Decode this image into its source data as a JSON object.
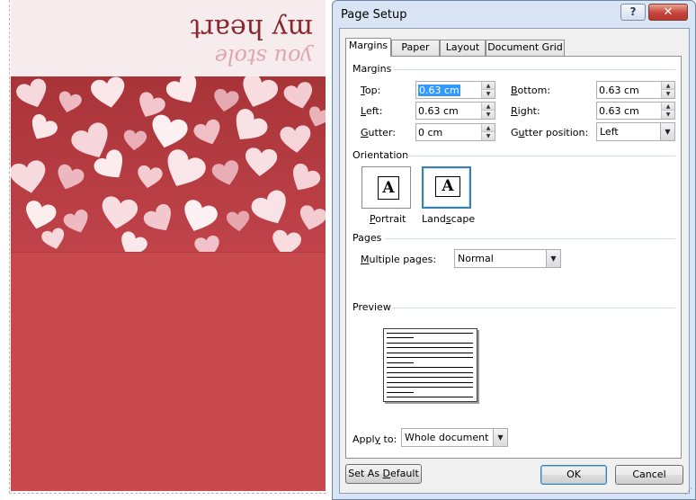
{
  "card": {
    "line1": "you stole",
    "line2": "my heart"
  },
  "dialog": {
    "title": "Page Setup",
    "help_label": "?",
    "close_label": "✕",
    "tabs": [
      {
        "label": "Margins",
        "active": true
      },
      {
        "label": "Paper",
        "active": false
      },
      {
        "label": "Layout",
        "active": false
      },
      {
        "label": "Document Grid",
        "active": false
      }
    ],
    "margins": {
      "section": "Margins",
      "top_label": "Top:",
      "top": "0.63 cm",
      "bottom_label": "Bottom:",
      "bottom": "0.63 cm",
      "left_label": "Left:",
      "left": "0.63 cm",
      "right_label": "Right:",
      "right": "0.63 cm",
      "gutter_label": "Gutter:",
      "gutter": "0 cm",
      "gutter_pos_label": "Gutter position:",
      "gutter_pos": "Left"
    },
    "orientation": {
      "section": "Orientation",
      "glyph": "A",
      "portrait": "Portrait",
      "landscape": "Landscape",
      "selected": "landscape"
    },
    "pages": {
      "section": "Pages",
      "multiple_label": "Multiple pages:",
      "multiple_value": "Normal"
    },
    "preview": {
      "section": "Preview"
    },
    "apply": {
      "label": "Apply to:",
      "value": "Whole document"
    },
    "buttons": {
      "set_default": "Set As Default",
      "ok": "OK",
      "cancel": "Cancel"
    }
  },
  "colors": {
    "card_red": "#c8494c",
    "pattern_red": "#a83438",
    "banner": "#f6ecee",
    "dialog_frame": "#d9e5f4",
    "accent_blue": "#3c7fb1"
  }
}
